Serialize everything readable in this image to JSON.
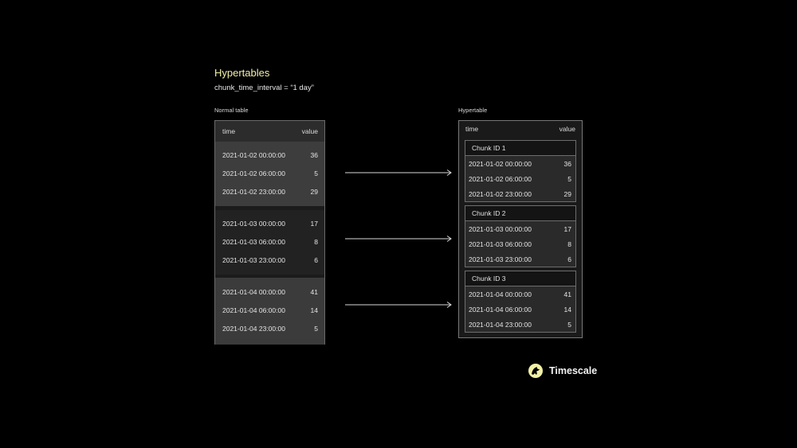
{
  "title": "Hypertables",
  "subtitle": "chunk_time_interval = “1 day”",
  "normal_table": {
    "label": "Normal table",
    "col_time": "time",
    "col_value": "value",
    "groups": [
      {
        "rows": [
          {
            "time": "2021-01-02 00:00:00",
            "value": "36"
          },
          {
            "time": "2021-01-02 06:00:00",
            "value": "5"
          },
          {
            "time": "2021-01-02 23:00:00",
            "value": "29"
          }
        ]
      },
      {
        "rows": [
          {
            "time": "2021-01-03 00:00:00",
            "value": "17"
          },
          {
            "time": "2021-01-03 06:00:00",
            "value": "8"
          },
          {
            "time": "2021-01-03 23:00:00",
            "value": "6"
          }
        ]
      },
      {
        "rows": [
          {
            "time": "2021-01-04 00:00:00",
            "value": "41"
          },
          {
            "time": "2021-01-04 06:00:00",
            "value": "14"
          },
          {
            "time": "2021-01-04 23:00:00",
            "value": "5"
          }
        ]
      }
    ]
  },
  "hypertable": {
    "label": "Hypertable",
    "col_time": "time",
    "col_value": "value",
    "chunks": [
      {
        "name": "Chunk ID 1",
        "rows": [
          {
            "time": "2021-01-02 00:00:00",
            "value": "36"
          },
          {
            "time": "2021-01-02 06:00:00",
            "value": "5"
          },
          {
            "time": "2021-01-02 23:00:00",
            "value": "29"
          }
        ]
      },
      {
        "name": "Chunk ID 2",
        "rows": [
          {
            "time": "2021-01-03 00:00:00",
            "value": "17"
          },
          {
            "time": "2021-01-03 06:00:00",
            "value": "8"
          },
          {
            "time": "2021-01-03 23:00:00",
            "value": "6"
          }
        ]
      },
      {
        "name": "Chunk ID 3",
        "rows": [
          {
            "time": "2021-01-04 00:00:00",
            "value": "41"
          },
          {
            "time": "2021-01-04 06:00:00",
            "value": "14"
          },
          {
            "time": "2021-01-04 23:00:00",
            "value": "5"
          }
        ]
      }
    ]
  },
  "brand": {
    "name": "Timescale",
    "icon": "timescale-logo-icon",
    "accent": "#f2f0a6"
  },
  "colors": {
    "background": "#000000",
    "title": "#f2f0a6"
  }
}
